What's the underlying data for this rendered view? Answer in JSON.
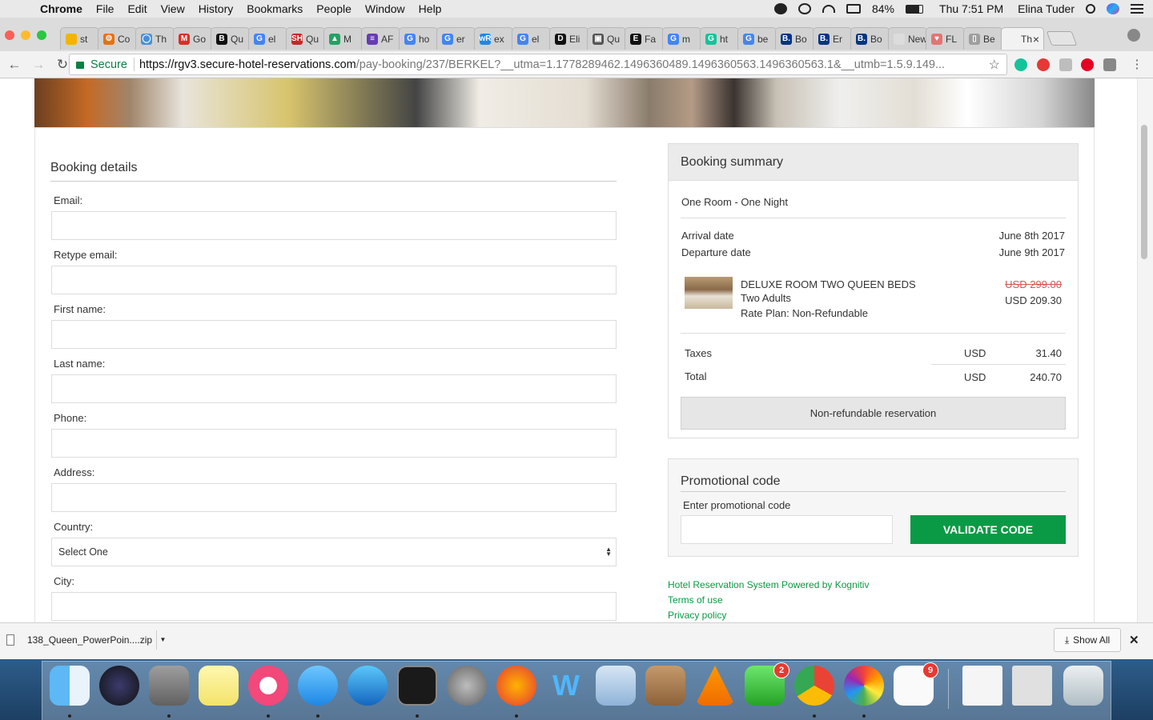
{
  "menubar": {
    "app": "Chrome",
    "menus": [
      "File",
      "Edit",
      "View",
      "History",
      "Bookmarks",
      "People",
      "Window",
      "Help"
    ],
    "battery": "84%",
    "clock": "Thu 7:51 PM",
    "user": "Elina Tuder"
  },
  "tabs": [
    {
      "label": "st",
      "color": "#f4b400",
      "glyph": ""
    },
    {
      "label": "Co",
      "color": "#e8710a",
      "glyph": "⚙"
    },
    {
      "label": "Th",
      "color": "#4a90d9",
      "glyph": "◯"
    },
    {
      "label": "Go",
      "color": "#d93025",
      "glyph": "M"
    },
    {
      "label": "Qu",
      "color": "#111111",
      "glyph": "B"
    },
    {
      "label": "el",
      "color": "#4285f4",
      "glyph": "G"
    },
    {
      "label": "Qu",
      "color": "#c62828",
      "glyph": "SH"
    },
    {
      "label": "M",
      "color": "#1fa463",
      "glyph": "▲"
    },
    {
      "label": "AF",
      "color": "#673ab7",
      "glyph": "≡"
    },
    {
      "label": "ho",
      "color": "#4285f4",
      "glyph": "G"
    },
    {
      "label": "er",
      "color": "#4285f4",
      "glyph": "G"
    },
    {
      "label": "ex",
      "color": "#1e88e5",
      "glyph": "wR"
    },
    {
      "label": "el",
      "color": "#4285f4",
      "glyph": "G"
    },
    {
      "label": "Eli",
      "color": "#111111",
      "glyph": "D"
    },
    {
      "label": "Qu",
      "color": "#555555",
      "glyph": "▣"
    },
    {
      "label": "Fa",
      "color": "#111111",
      "glyph": "E"
    },
    {
      "label": "m",
      "color": "#4285f4",
      "glyph": "G"
    },
    {
      "label": "ht",
      "color": "#15c39a",
      "glyph": "G"
    },
    {
      "label": "be",
      "color": "#4285f4",
      "glyph": "G"
    },
    {
      "label": "Bo",
      "color": "#003580",
      "glyph": "B."
    },
    {
      "label": "Er",
      "color": "#003580",
      "glyph": "B."
    },
    {
      "label": "Bo",
      "color": "#003580",
      "glyph": "B."
    },
    {
      "label": "New",
      "color": "#dcdcdc",
      "glyph": ""
    },
    {
      "label": "FL",
      "color": "#e57373",
      "glyph": "♥"
    },
    {
      "label": "Be",
      "color": "#9e9e9e",
      "glyph": "▯"
    },
    {
      "label": "Th",
      "color": "#f2f2f2",
      "glyph": "",
      "active": true
    }
  ],
  "toolbar": {
    "secure": "Secure",
    "url_host": "https://rgv3.secure-hotel-reservations.com",
    "url_rest": "/pay-booking/237/BERKEL?__utma=1.1778289462.1496360489.1496360563.1496360563.1&__utmb=1.5.9.149..."
  },
  "booking": {
    "title": "Booking details",
    "fields": {
      "email": "Email:",
      "retype_email": "Retype email:",
      "first_name": "First name:",
      "last_name": "Last name:",
      "phone": "Phone:",
      "address": "Address:",
      "country": "Country:",
      "country_value": "Select One",
      "city": "City:"
    }
  },
  "summary": {
    "title": "Booking summary",
    "stay": "One Room - One Night",
    "arrival_label": "Arrival date",
    "arrival_value": "June 8th 2017",
    "departure_label": "Departure date",
    "departure_value": "June 9th 2017",
    "room_name": "DELUXE ROOM TWO QUEEN BEDS",
    "guests": "Two Adults",
    "rate_plan": "Rate Plan: Non-Refundable",
    "old_price": "USD 299.00",
    "new_price": "USD 209.30",
    "taxes_label": "Taxes",
    "taxes_currency": "USD",
    "taxes_value": "31.40",
    "total_label": "Total",
    "total_currency": "USD",
    "total_value": "240.70",
    "nonref": "Non-refundable reservation"
  },
  "promo": {
    "title": "Promotional code",
    "label": "Enter promotional code",
    "button": "VALIDATE CODE"
  },
  "footer": {
    "powered": "Hotel Reservation System Powered by Kognitiv",
    "terms": "Terms of use",
    "privacy": "Privacy policy"
  },
  "downloads": {
    "file": "138_Queen_PowerPoin....zip",
    "show_all": "Show All"
  },
  "dock_badges": {
    "facetime": "2",
    "reminders": "9"
  },
  "colors": {
    "accent_green": "#0a9a45",
    "strike_red": "#d9534f"
  }
}
